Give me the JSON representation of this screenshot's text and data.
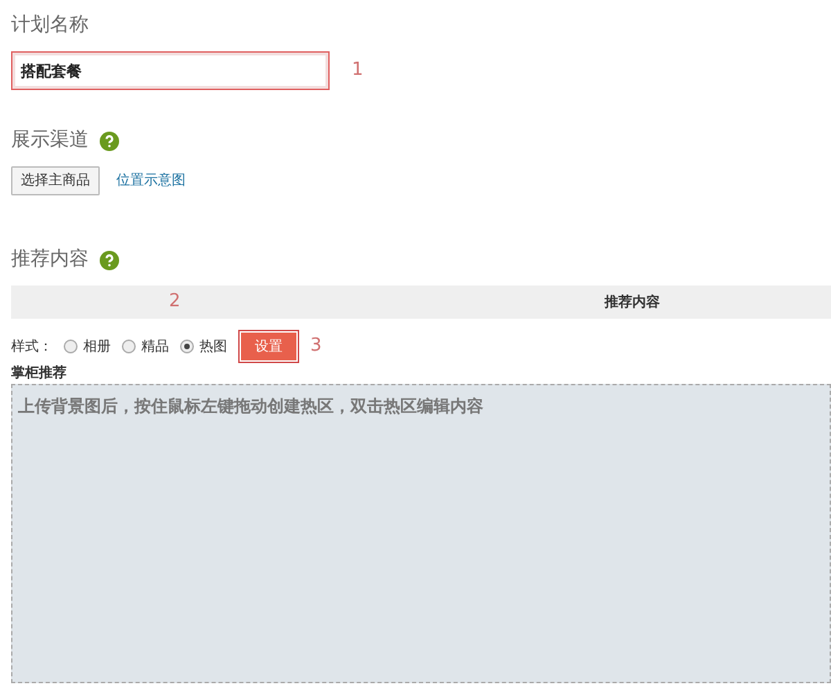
{
  "plan_name": {
    "label": "计划名称",
    "value": "搭配套餐",
    "annotation": "1"
  },
  "channel": {
    "label": "展示渠道",
    "help": true,
    "button": "选择主商品",
    "link": "位置示意图"
  },
  "recommend": {
    "label": "推荐内容",
    "help": true,
    "header_annotation": "2",
    "header_column": "推荐内容",
    "style_label": "样式：",
    "styles": [
      {
        "label": "相册",
        "selected": false
      },
      {
        "label": "精品",
        "selected": false
      },
      {
        "label": "热图",
        "selected": true
      }
    ],
    "settings_button": "设置",
    "settings_annotation": "3",
    "section_title": "掌柜推荐",
    "hint": "上传背景图后，按住鼠标左键拖动创建热区，双击热区编辑内容"
  }
}
